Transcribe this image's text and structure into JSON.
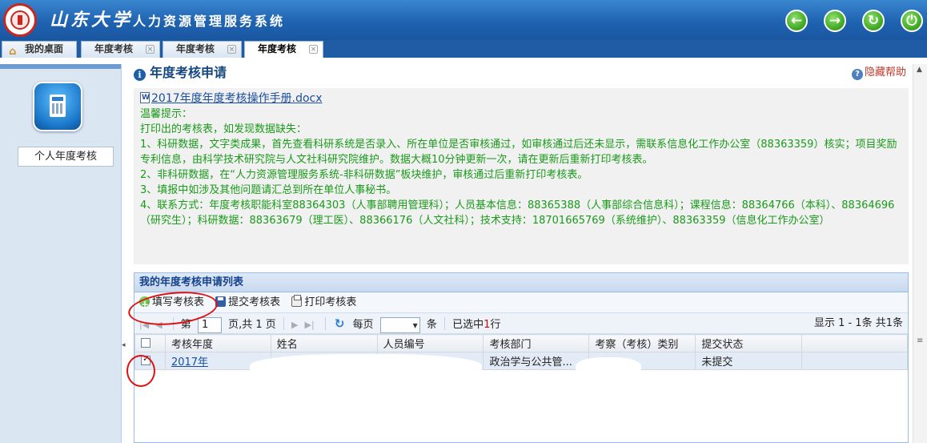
{
  "header": {
    "school_name": "山东大学",
    "system_name": "人力资源管理服务系统",
    "buttons": [
      {
        "name": "back",
        "glyph": "←"
      },
      {
        "name": "forward",
        "glyph": "→"
      },
      {
        "name": "refresh",
        "glyph": "↻"
      },
      {
        "name": "power",
        "glyph": "⏻"
      }
    ]
  },
  "tabs": [
    {
      "label": "我的桌面",
      "closable": false
    },
    {
      "label": "年度考核",
      "closable": true
    },
    {
      "label": "年度考核",
      "closable": true
    },
    {
      "label": "年度考核",
      "closable": true,
      "active": true
    }
  ],
  "sidebar": {
    "items": [
      {
        "label": "个人年度考核"
      }
    ]
  },
  "page": {
    "title": "年度考核申请",
    "help_label": "隐藏帮助"
  },
  "notice": {
    "doc_link": "2017年度年度考核操作手册.docx",
    "lines": [
      "温馨提示：",
      "打印出的考核表，如发现数据缺失：",
      "1、科研数据，文字类成果，首先查看科研系统是否录入、所在单位是否审核通过，如审核通过后还未显示，需联系信息化工作办公室（88363359）核实；项目奖励专利信息，由科学技术研究院与人文社科研究院维护。数据大概10分钟更新一次，请在更新后重新打印考核表。",
      "2、非科研数据，在“人力资源管理服务系统-非科研数据”板块维护，审核通过后重新打印考核表。",
      "3、填报中如涉及其他问题请汇总到所在单位人事秘书。",
      "4、联系方式：年度考核职能科室88364303（人事部聘用管理科）；人员基本信息：88365388（人事部综合信息科）；课程信息：88364766（本科）、88364696（研究生）；科研数据：88363679（理工医）、88366176（人文社科）；技术支持：18701665769（系统维护）、88363359（信息化工作办公室）"
    ]
  },
  "grid": {
    "title": "我的年度考核申请列表",
    "toolbar": {
      "fill": "填写考核表",
      "submit": "提交考核表",
      "print": "打印考核表"
    },
    "pager": {
      "page_prefix": "第",
      "page": "1",
      "page_suffix": "页,共 1 页",
      "per_page": "每页",
      "unit": "条",
      "selected_prefix": "已选中",
      "selected_count": "1",
      "selected_suffix": "行",
      "display": "显示 1 - 1条 共1条"
    },
    "columns": [
      "考核年度",
      "姓名",
      "人员编号",
      "考核部门",
      "考察（考核）类别",
      "提交状态"
    ],
    "rows": [
      {
        "year": "2017年",
        "name": "",
        "id": "",
        "dept": "政治学与公共管...",
        "category": "",
        "status": "未提交",
        "checked": true
      }
    ]
  },
  "colors": {
    "header_blue": "#1f63b1",
    "notice_green": "#1a9a1a",
    "annotation_red": "#e01010"
  }
}
